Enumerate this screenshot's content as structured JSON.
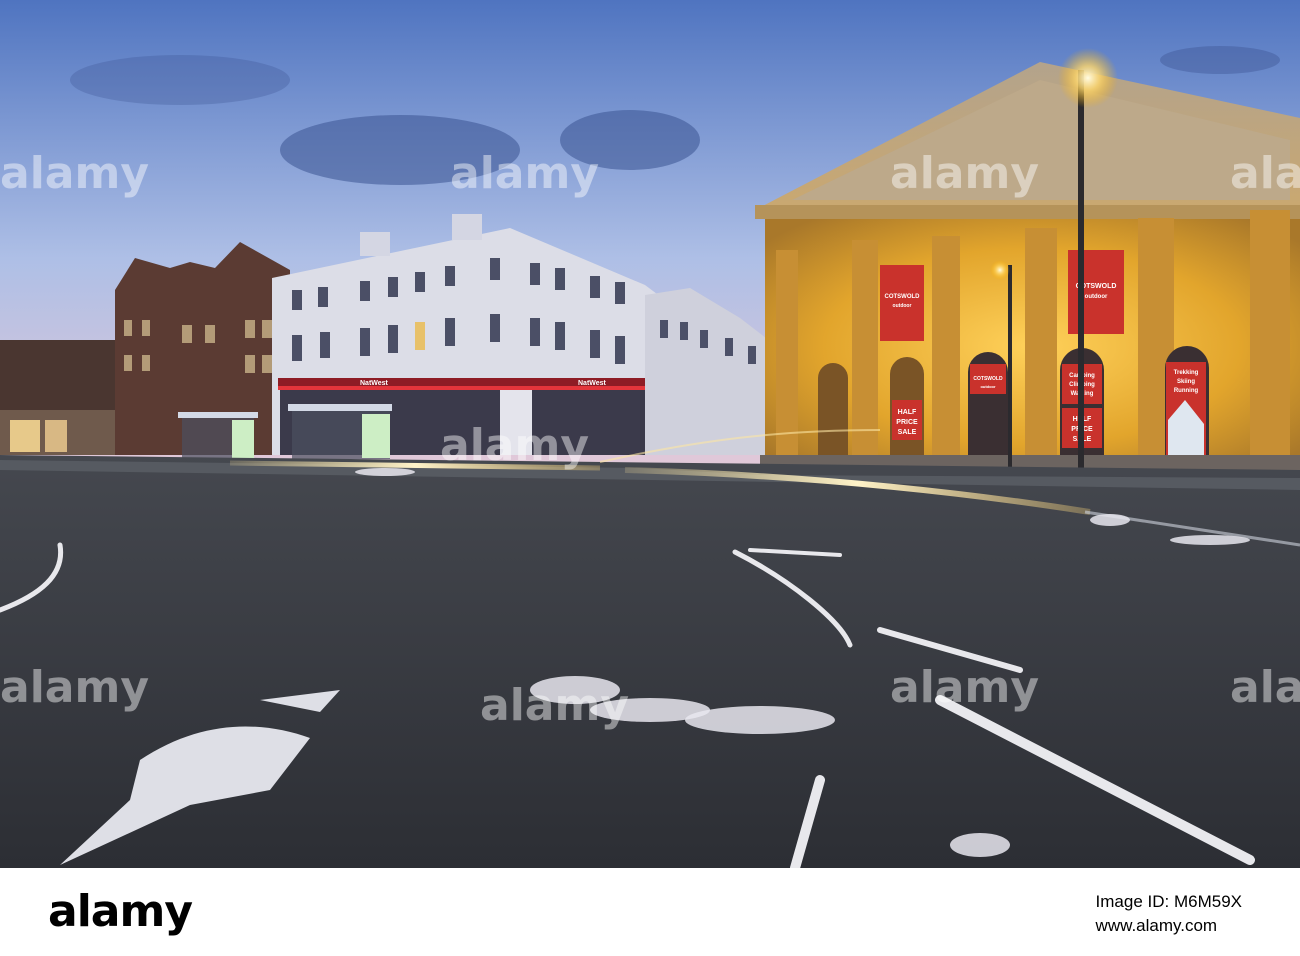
{
  "watermark": {
    "brand": "alamy",
    "copies": [
      "alamy",
      "alamy",
      "alamy",
      "alamy",
      "alamy",
      "alamy",
      "alamy",
      "alamy",
      "alamy"
    ]
  },
  "signs": {
    "banner_left_brand": "COTSWOLD",
    "banner_left_sub": "outdoor",
    "banner_right_brand": "COTSWOLD",
    "banner_right_sub": "outdoor",
    "arch_brand": "COTSWOLD",
    "arch_sub": "outdoor",
    "sale_left_1": "HALF",
    "sale_left_2": "PRICE",
    "sale_left_3": "SALE",
    "activities_left_1": "Camping",
    "activities_left_2": "Climbing",
    "activities_left_3": "Walking",
    "sale_right_1": "HALF",
    "sale_right_2": "PRICE",
    "sale_right_3": "SALE",
    "activities_right_1": "Trekking",
    "activities_right_2": "Skiing",
    "activities_right_3": "Running",
    "bank_left": "NatWest",
    "bank_right": "NatWest"
  },
  "footer": {
    "logo": "alamy",
    "image_id_line": "Image ID: M6M59X",
    "url": "www.alamy.com"
  },
  "colors": {
    "sky_top": "#5a7dc4",
    "sky_bottom": "#c9d3ec",
    "portico_glow": "#f2b531",
    "road": "#3b3d44",
    "banner_red": "#c9322c"
  }
}
